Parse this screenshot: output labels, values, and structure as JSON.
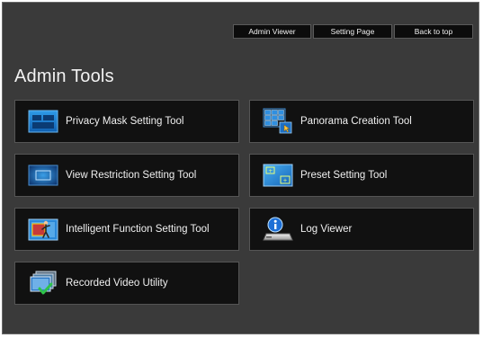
{
  "topnav": {
    "admin_viewer": "Admin Viewer",
    "setting_page": "Setting Page",
    "back_to_top": "Back to top"
  },
  "page_title": "Admin Tools",
  "tools": [
    {
      "label": "Privacy Mask Setting Tool",
      "icon": "privacy-mask-icon"
    },
    {
      "label": "Panorama Creation Tool",
      "icon": "panorama-grid-icon"
    },
    {
      "label": "View Restriction Setting Tool",
      "icon": "view-restriction-icon"
    },
    {
      "label": "Preset Setting Tool",
      "icon": "preset-icon"
    },
    {
      "label": "Intelligent Function Setting Tool",
      "icon": "intelligent-function-icon"
    },
    {
      "label": "Log Viewer",
      "icon": "log-viewer-icon"
    },
    {
      "label": "Recorded Video Utility",
      "icon": "recorded-video-icon"
    }
  ],
  "colors": {
    "background": "#3a3a3a",
    "tile": "#111111",
    "text": "#f0f0f0",
    "icon_blue": "#1f7fd6"
  }
}
